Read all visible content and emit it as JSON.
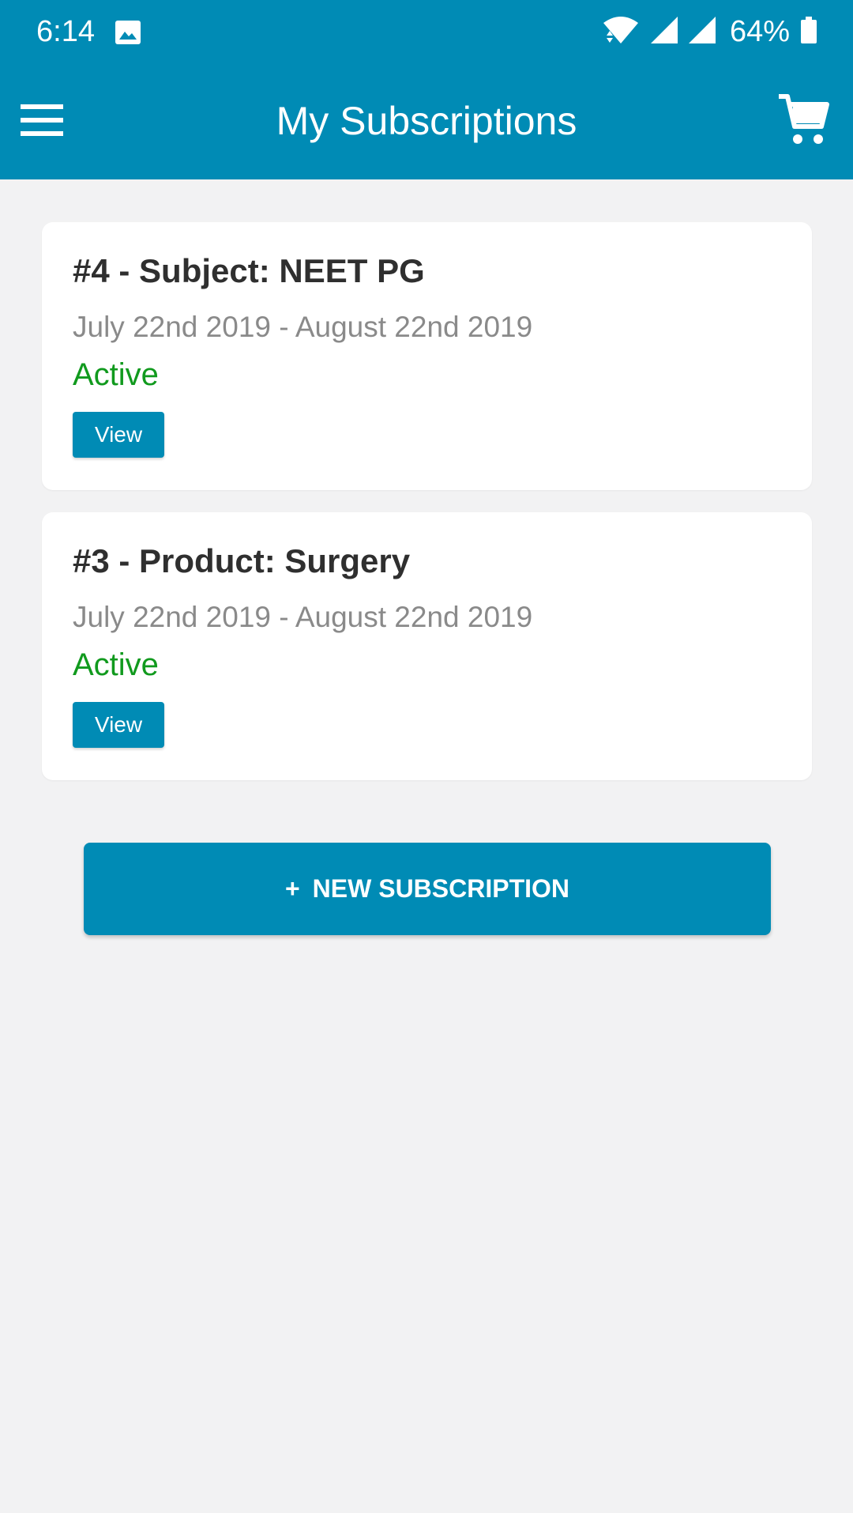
{
  "status_bar": {
    "time": "6:14",
    "battery_percent": "64%"
  },
  "header": {
    "title": "My Subscriptions"
  },
  "subscriptions": [
    {
      "title": "#4 - Subject: NEET PG",
      "dates": "July 22nd 2019 - August 22nd 2019",
      "status": "Active",
      "view_label": "View"
    },
    {
      "title": "#3 - Product: Surgery",
      "dates": "July 22nd 2019 - August 22nd 2019",
      "status": "Active",
      "view_label": "View"
    }
  ],
  "new_subscription": {
    "plus": "+",
    "label": "NEW SUBSCRIPTION"
  },
  "icons": {
    "status_image": "image-icon",
    "wifi": "wifi-icon",
    "signal": "signal-icon",
    "battery": "battery-icon",
    "menu": "hamburger-menu-icon",
    "cart": "shopping-cart-icon"
  },
  "colors": {
    "primary": "#008bb5",
    "background": "#f2f2f3",
    "card": "#ffffff",
    "title_text": "#2f2f2f",
    "date_text": "#8a8a8a",
    "active_status": "#119a1e"
  }
}
